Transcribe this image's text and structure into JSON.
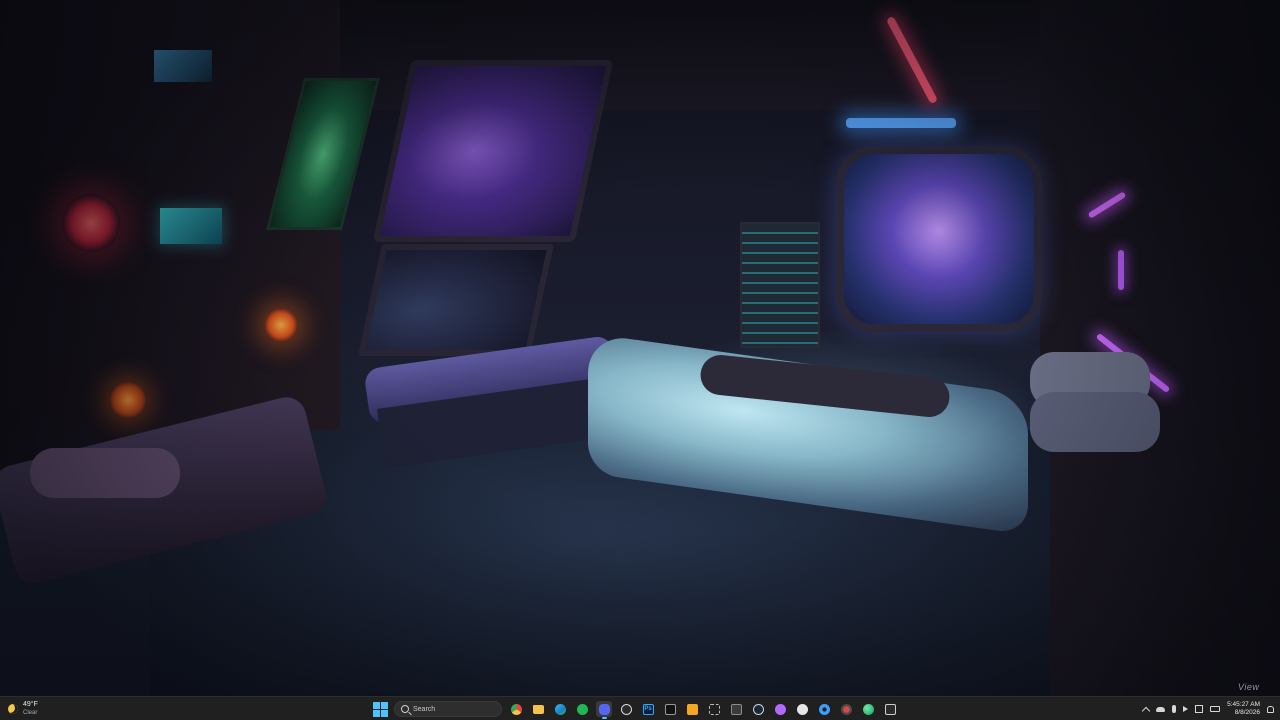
{
  "desktop": {
    "wallpaper": "sci-fi spaceship bedroom with neon lights and galaxy windows",
    "watermark": "View"
  },
  "taskbar": {
    "weather": {
      "temperature": "49°F",
      "condition": "Clear",
      "icon": "moon-icon"
    },
    "start": {
      "icon": "windows-start-icon"
    },
    "search": {
      "placeholder": "Search",
      "icon": "search-icon"
    },
    "apps": [
      {
        "name": "Chrome",
        "icon": "chrome-icon",
        "color": "#e8453c",
        "active": false
      },
      {
        "name": "File Explorer",
        "icon": "folder-icon",
        "color": "#f2c14e",
        "active": false
      },
      {
        "name": "Edge",
        "icon": "edge-icon",
        "color": "#1fa2c9",
        "active": false
      },
      {
        "name": "Spotify",
        "icon": "spotify-icon",
        "color": "#1db954",
        "active": false
      },
      {
        "name": "Discord",
        "icon": "discord-icon",
        "color": "#5865f2",
        "active": true
      },
      {
        "name": "OBS",
        "icon": "obs-icon",
        "color": "#d9d9d9",
        "active": false
      },
      {
        "name": "Photoshop",
        "icon": "photoshop-icon",
        "label": "Ps",
        "color": "#31a8ff",
        "active": false
      },
      {
        "name": "Terminal",
        "icon": "terminal-icon",
        "color": "#9a9a9a",
        "active": false
      },
      {
        "name": "Notes",
        "icon": "notes-icon",
        "color": "#f5a623",
        "active": false
      },
      {
        "name": "Capture",
        "icon": "capture-icon",
        "color": "#b9b9b9",
        "active": false
      },
      {
        "name": "App",
        "icon": "app-icon",
        "color": "#8c8c8c",
        "active": false
      },
      {
        "name": "Steam",
        "icon": "steam-icon",
        "color": "#c7d5e0",
        "active": false
      },
      {
        "name": "Launcher",
        "icon": "launcher-icon",
        "color": "#b36bff",
        "active": false
      },
      {
        "name": "Browser",
        "icon": "browser-icon",
        "color": "#e6e6e6",
        "active": false
      },
      {
        "name": "Settings",
        "icon": "gear-icon",
        "color": "#3aa0ff",
        "active": false
      },
      {
        "name": "Record",
        "icon": "record-icon",
        "color": "#e04545",
        "active": false
      },
      {
        "name": "Globe",
        "icon": "globe-icon",
        "color": "#2ec27e",
        "active": false
      },
      {
        "name": "Editor",
        "icon": "editor-icon",
        "color": "#cfcfcf",
        "active": false
      }
    ],
    "tray": {
      "icons": [
        "chevron-up-icon",
        "onedrive-icon",
        "microphone-icon",
        "volume-icon",
        "network-icon",
        "battery-icon"
      ],
      "time": "5:45:27 AM",
      "date": "8/8/2026",
      "notification_icon": "bell-icon"
    }
  }
}
